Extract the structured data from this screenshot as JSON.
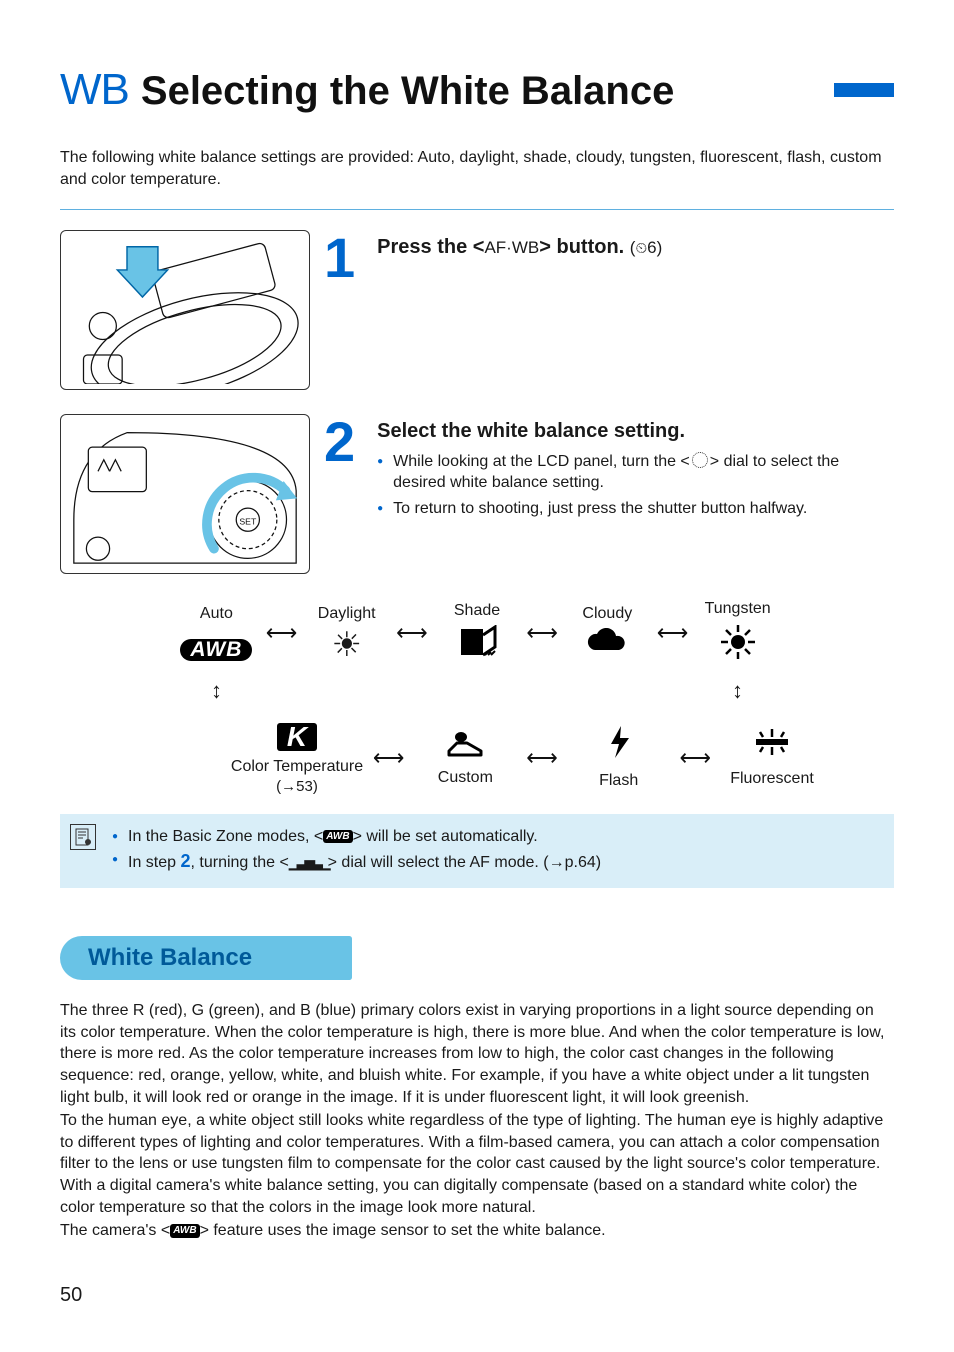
{
  "title": {
    "prefix": "WB",
    "main": "Selecting the White Balance"
  },
  "intro": "The following white balance settings are provided: Auto, daylight, shade, cloudy, tungsten, fluorescent, flash, custom and color temperature.",
  "step1": {
    "number": "1",
    "head_pre": "Press the <",
    "button_label": "AF·WB",
    "head_post": "> button.",
    "timer": "6"
  },
  "step2": {
    "number": "2",
    "heading": "Select the white balance setting.",
    "b1a": "While looking at the LCD panel, turn the <",
    "b1b": "> dial to select the desired white balance setting.",
    "b2": "To return to shooting, just press the shutter button halfway."
  },
  "wb_items_top": [
    {
      "label": "Auto",
      "icon_name": "awb-icon"
    },
    {
      "label": "Daylight",
      "icon_name": "sun-icon"
    },
    {
      "label": "Shade",
      "icon_name": "shade-icon"
    },
    {
      "label": "Cloudy",
      "icon_name": "cloud-icon"
    },
    {
      "label": "Tungsten",
      "icon_name": "bulb-icon"
    }
  ],
  "wb_items_bottom": [
    {
      "label": "Color Temperature",
      "sub": "(→53)",
      "icon_name": "k-icon"
    },
    {
      "label": "Custom",
      "icon_name": "custom-icon"
    },
    {
      "label": "Flash",
      "icon_name": "flash-icon"
    },
    {
      "label": "Fluorescent",
      "icon_name": "fluorescent-icon"
    }
  ],
  "notes": {
    "n1a": "In the Basic Zone modes, <",
    "n1b": "> will be set automatically.",
    "n2a": "In step ",
    "n2step": "2",
    "n2b": ", turning the <",
    "n2c": "> dial will select the AF mode. (→p.64)"
  },
  "section_heading": "White Balance",
  "para1": "The three R (red), G (green), and B (blue) primary colors exist in varying proportions in a light source depending on its color temperature. When the color temperature is high, there is more blue. And when the color temperature is low, there is more red. As the color temperature increases from low to high, the color cast changes in the following sequence: red, orange, yellow, white, and bluish white. For example, if you have a white object under a lit tungsten light bulb, it will look red or orange in the image. If it is under fluorescent light, it will look greenish.",
  "para2": "To the human eye, a white object still looks white regardless of the type of lighting. The human eye is highly adaptive to different types of lighting and color temperatures. With a film-based camera, you can attach a color compensation filter to the lens or use tungsten film to compensate for the color cast caused by the light source's color temperature. With a digital camera's white balance setting, you can digitally compensate (based on a standard white color) the color temperature so that the colors in the image look more natural.",
  "para3a": "The camera's <",
  "para3b": "> feature uses the image sensor to set the white balance.",
  "page_number": "50"
}
